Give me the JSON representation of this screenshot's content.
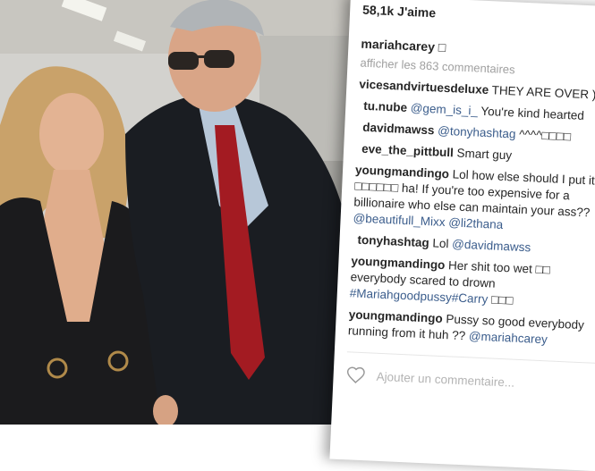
{
  "post": {
    "likes": "58,1k J'aime",
    "author": "mariahcarey",
    "caption_text": " □",
    "view_more": "afficher les 863 commentaires"
  },
  "comments": [
    {
      "user": "vicesandvirtuesdeluxe",
      "text": " THEY ARE OVER ):"
    },
    {
      "user": "tu.nube",
      "mention": " @gem_is_i_",
      "text": " You're kind hearted"
    },
    {
      "user": "davidmawss",
      "mention": " @tonyhashtag",
      "text": " ^^^^□□□□"
    },
    {
      "user": "eve_the_pittbull",
      "text": " Smart guy"
    },
    {
      "user": "youngmandingo",
      "text": " Lol how else should I put it □□□□□□ ha! If you're too expensive for a billionaire who else can maintain your ass?? ",
      "mention": "@beautifull_Mixx @li2thana"
    },
    {
      "user": "tonyhashtag",
      "text": " Lol ",
      "mention": "@davidmawss"
    },
    {
      "user": "youngmandingo",
      "text": " Her shit too wet □□ everybody scared to drown ",
      "mention": "#Mariahgoodpussy#Carry",
      "tail": " □□□"
    },
    {
      "user": "youngmandingo",
      "text": " Pussy so good everybody running from it huh ?? ",
      "mention": "@mariahcarey"
    }
  ],
  "add_comment": {
    "placeholder": "Ajouter un commentaire..."
  },
  "colors": {
    "accent_link": "#3b5d8c",
    "text": "#262626",
    "muted": "#a0a0a0"
  }
}
